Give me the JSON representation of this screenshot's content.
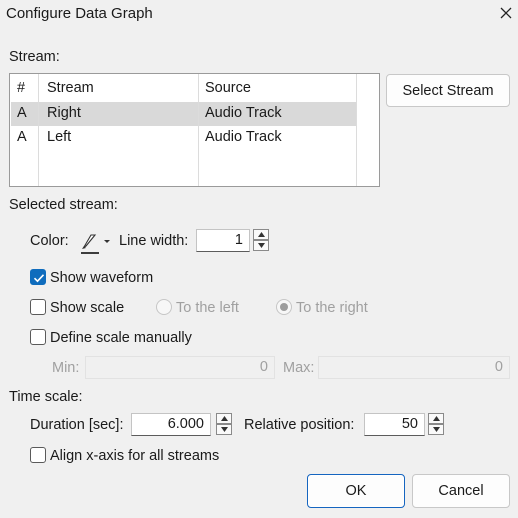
{
  "dialog": {
    "title": "Configure Data Graph"
  },
  "stream_section": {
    "label": "Stream:"
  },
  "stream_table": {
    "headers": [
      "#",
      "Stream",
      "Source"
    ],
    "rows": [
      {
        "num": "A",
        "stream": "Right",
        "source": "Audio Track",
        "selected": true
      },
      {
        "num": "A",
        "stream": "Left",
        "source": "Audio Track",
        "selected": false
      }
    ]
  },
  "select_stream_button": "Select Stream",
  "selected_stream": {
    "label": "Selected stream:",
    "color_label": "Color:",
    "color_icon": "brush-icon",
    "line_width_label": "Line width:",
    "line_width_value": "1",
    "show_waveform": {
      "label": "Show waveform",
      "checked": true
    },
    "show_scale": {
      "label": "Show scale",
      "checked": false
    },
    "to_the_left": {
      "label": "To the left",
      "selected": false
    },
    "to_the_right": {
      "label": "To the right",
      "selected": true
    },
    "define_scale": {
      "label": "Define scale manually",
      "checked": false
    },
    "min_label": "Min:",
    "min_value": "0",
    "max_label": "Max:",
    "max_value": "0"
  },
  "time_scale": {
    "label": "Time scale:",
    "duration_label": "Duration [sec]:",
    "duration_value": "6.000",
    "relative_position_label": "Relative position:",
    "relative_position_value": "50",
    "align_x_axis": {
      "label": "Align x-axis for all streams",
      "checked": false
    }
  },
  "buttons": {
    "ok": "OK",
    "cancel": "Cancel"
  },
  "colors": {
    "accent": "#0f6cbd",
    "selection": "#d9d9d9",
    "window": "#f0f0f0"
  }
}
